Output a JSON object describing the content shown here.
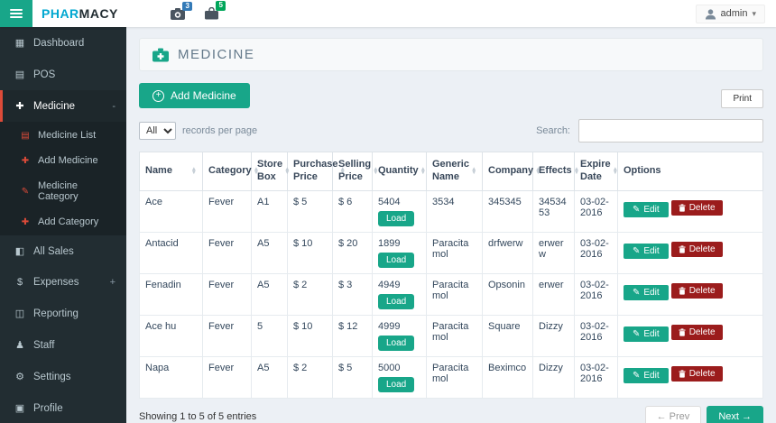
{
  "colors": {
    "teal": "#18a689",
    "dark_red": "#9b1c1c",
    "sidebar_bg": "#222d32",
    "brand_blue": "#00a7d0",
    "red_accent": "#dd4b39"
  },
  "topbar": {
    "brand_prefix": "PHAR",
    "brand_suffix": "MACY",
    "notifications": [
      {
        "icon": "camera-icon",
        "count": "3",
        "badge_color": "#337ab7"
      },
      {
        "icon": "bag-icon",
        "count": "5",
        "badge_color": "#00a65a"
      }
    ],
    "user_label": "admin"
  },
  "sidebar": {
    "items": [
      {
        "label": "Dashboard",
        "icon": "dashboard-icon"
      },
      {
        "label": "POS",
        "icon": "pos-icon"
      },
      {
        "label": "Medicine",
        "icon": "medicine-icon",
        "active": true,
        "toggle": "-",
        "children": [
          {
            "label": "Medicine List",
            "icon": "list-icon"
          },
          {
            "label": "Add Medicine",
            "icon": "plus-icon"
          },
          {
            "label": "Medicine Category",
            "icon": "edit-icon"
          },
          {
            "label": "Add Category",
            "icon": "plus-icon"
          }
        ]
      },
      {
        "label": "All Sales",
        "icon": "sales-icon"
      },
      {
        "label": "Expenses",
        "icon": "expenses-icon",
        "toggle": "+"
      },
      {
        "label": "Reporting",
        "icon": "reporting-icon"
      },
      {
        "label": "Staff",
        "icon": "staff-icon"
      },
      {
        "label": "Settings",
        "icon": "settings-icon"
      },
      {
        "label": "Profile",
        "icon": "profile-icon"
      }
    ]
  },
  "main": {
    "page_title": "MEDICINE",
    "add_medicine_label": "Add Medicine",
    "print_label": "Print",
    "records_select_value": "All",
    "records_per_page_label": "records per page",
    "search_label": "Search:",
    "table": {
      "columns": [
        "Name",
        "Category",
        "Store Box",
        "Purchase Price",
        "Selling Price",
        "Quantity",
        "Generic Name",
        "Company",
        "Effects",
        "Expire Date",
        "Options"
      ],
      "load_label": "Load",
      "edit_label": "Edit",
      "delete_label": "Delete",
      "rows": [
        {
          "name": "Ace",
          "category": "Fever",
          "store_box": "A1",
          "purchase_price": "$ 5",
          "selling_price": "$ 6",
          "quantity": "5404",
          "generic_name": "3534",
          "company": "345345",
          "effects": "3453453",
          "expire_date": "03-02-2016"
        },
        {
          "name": "Antacid",
          "category": "Fever",
          "store_box": "A5",
          "purchase_price": "$ 10",
          "selling_price": "$ 20",
          "quantity": "1899",
          "generic_name": "Paracitamol",
          "company": "drfwerw",
          "effects": "erwerw",
          "expire_date": "03-02-2016"
        },
        {
          "name": "Fenadin",
          "category": "Fever",
          "store_box": "A5",
          "purchase_price": "$ 2",
          "selling_price": "$ 3",
          "quantity": "4949",
          "generic_name": "Paracitamol",
          "company": "Opsonin",
          "effects": "erwer",
          "expire_date": "03-02-2016"
        },
        {
          "name": "Ace hu",
          "category": "Fever",
          "store_box": "5",
          "purchase_price": "$ 10",
          "selling_price": "$ 12",
          "quantity": "4999",
          "generic_name": "Paracitamol",
          "company": "Square",
          "effects": "Dizzy",
          "expire_date": "03-02-2016"
        },
        {
          "name": "Napa",
          "category": "Fever",
          "store_box": "A5",
          "purchase_price": "$ 2",
          "selling_price": "$ 5",
          "quantity": "5000",
          "generic_name": "Paracitamol",
          "company": "Beximco",
          "effects": "Dizzy",
          "expire_date": "03-02-2016"
        }
      ]
    },
    "footer": {
      "showing_text": "Showing 1 to 5 of 5 entries",
      "prev_label": "← Prev",
      "next_label": "Next →"
    }
  }
}
